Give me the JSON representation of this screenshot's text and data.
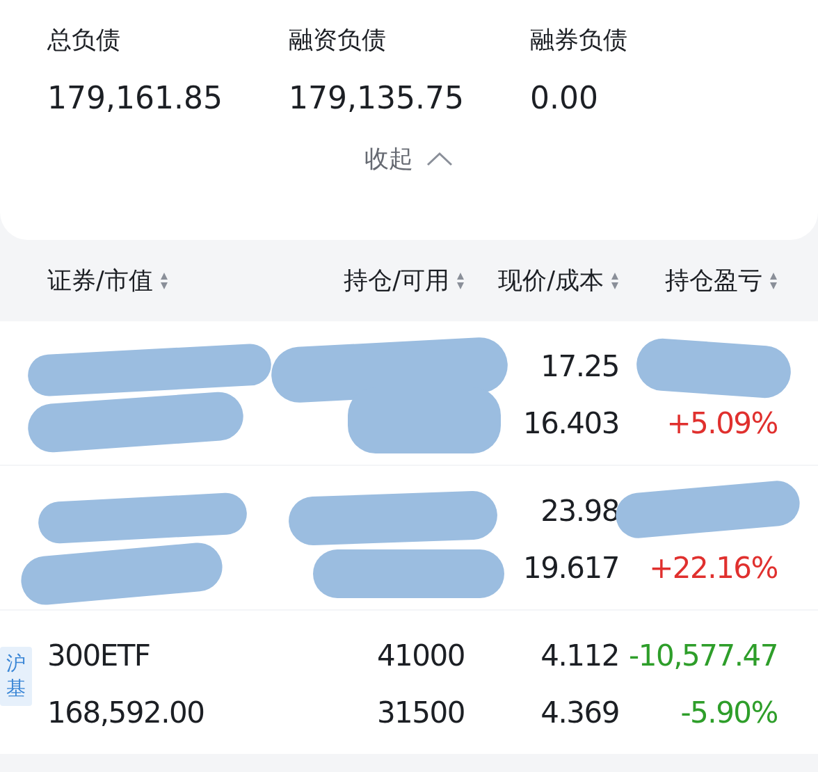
{
  "summary": [
    {
      "label": "总负债",
      "value": "179,161.85"
    },
    {
      "label": "融资负债",
      "value": "179,135.75"
    },
    {
      "label": "融券负债",
      "value": "0.00"
    }
  ],
  "collapse": {
    "label": "收起",
    "expanded": true
  },
  "table": {
    "columns": [
      {
        "label": "证券/市值"
      },
      {
        "label": "持仓/可用"
      },
      {
        "label": "现价/成本"
      },
      {
        "label": "持仓盈亏"
      }
    ],
    "rows": [
      {
        "redacted": true,
        "color": "#e0302e",
        "price": "17.25",
        "cost": "16.403",
        "pnl_pct": "+5.09%"
      },
      {
        "redacted": true,
        "color": "#e0302e",
        "price": "23.98",
        "cost": "19.617",
        "pnl_pct": "+22.16%"
      },
      {
        "redacted": false,
        "color": "#2e9e2a",
        "tag": "沪基",
        "name": "300ETF",
        "market_value": "168,592.00",
        "holding": "41000",
        "available": "31500",
        "price": "4.112",
        "cost": "4.369",
        "pnl": "-10,577.47",
        "pnl_pct": "-5.90%"
      }
    ]
  }
}
